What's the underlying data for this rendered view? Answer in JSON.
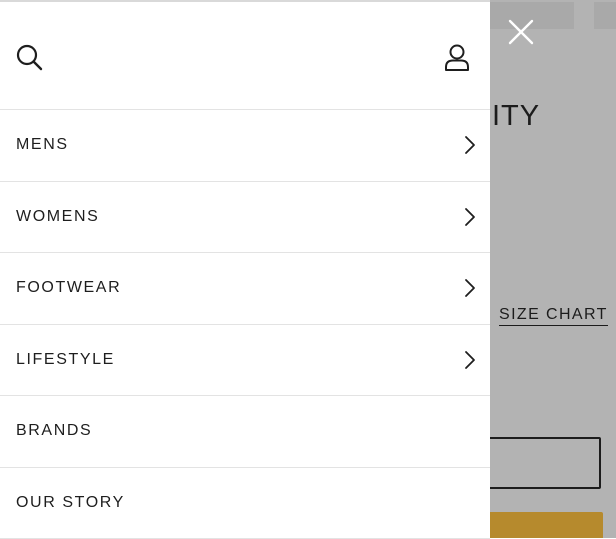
{
  "background": {
    "title_fragment": "NITY",
    "size_chart_label": "SIZE CHART"
  },
  "drawer": {
    "header": {
      "search_icon": "search-icon",
      "account_icon": "user-icon",
      "close_icon": "close-icon"
    },
    "menu": [
      {
        "label": "MENS",
        "has_submenu": true
      },
      {
        "label": "WOMENS",
        "has_submenu": true
      },
      {
        "label": "FOOTWEAR",
        "has_submenu": true
      },
      {
        "label": "LIFESTYLE",
        "has_submenu": true
      },
      {
        "label": "BRANDS",
        "has_submenu": false
      },
      {
        "label": "OUR STORY",
        "has_submenu": false
      }
    ]
  },
  "colors": {
    "overlay": "#b3b3b3",
    "drawer_bg": "#ffffff",
    "accent_gold": "#b68a2d",
    "text": "#1e1e1e"
  }
}
